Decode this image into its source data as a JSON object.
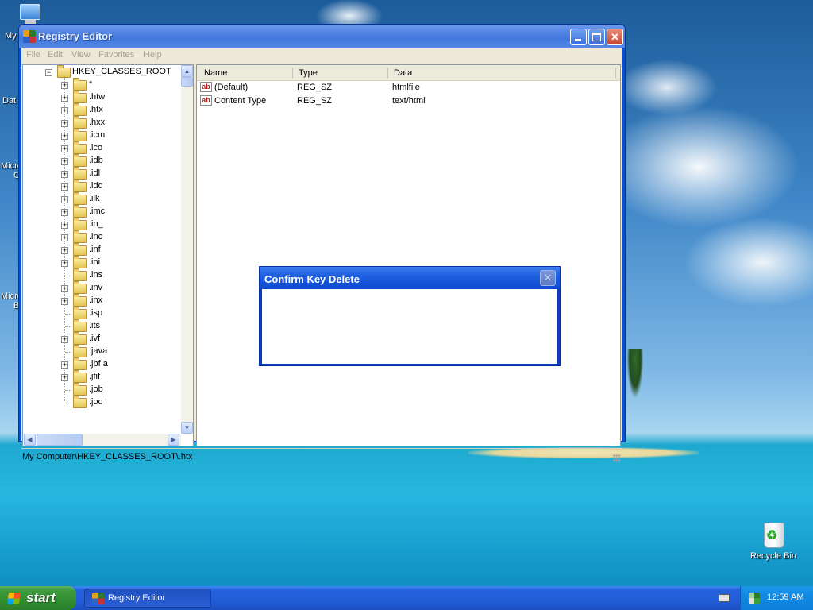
{
  "desktop": {
    "icons": [
      {
        "label": "My"
      },
      {
        "label": "Dat"
      },
      {
        "label": "Micro"
      },
      {
        "label": "C"
      },
      {
        "label": "Micro"
      },
      {
        "label": "B"
      }
    ],
    "recycle_bin": {
      "label": "Recycle Bin"
    }
  },
  "regedit": {
    "title": "Registry Editor",
    "menu": [
      "File",
      "Edit",
      "View",
      "Favorites",
      "Help"
    ],
    "tree": {
      "root": "HKEY_CLASSES_ROOT",
      "items": [
        {
          "label": "*",
          "expandable": true
        },
        {
          "label": ".htw",
          "expandable": true
        },
        {
          "label": ".htx",
          "expandable": true
        },
        {
          "label": ".hxx",
          "expandable": true
        },
        {
          "label": ".icm",
          "expandable": true
        },
        {
          "label": ".ico",
          "expandable": true
        },
        {
          "label": ".idb",
          "expandable": true
        },
        {
          "label": ".idl",
          "expandable": true
        },
        {
          "label": ".idq",
          "expandable": true
        },
        {
          "label": ".ilk",
          "expandable": true
        },
        {
          "label": ".imc",
          "expandable": true
        },
        {
          "label": ".in_",
          "expandable": true
        },
        {
          "label": ".inc",
          "expandable": true
        },
        {
          "label": ".inf",
          "expandable": true
        },
        {
          "label": ".ini",
          "expandable": true
        },
        {
          "label": ".ins",
          "expandable": false
        },
        {
          "label": ".inv",
          "expandable": true
        },
        {
          "label": ".inx",
          "expandable": true
        },
        {
          "label": ".isp",
          "expandable": false
        },
        {
          "label": ".its",
          "expandable": false
        },
        {
          "label": ".ivf",
          "expandable": true
        },
        {
          "label": ".java",
          "expandable": false
        },
        {
          "label": ".jbf a",
          "expandable": true
        },
        {
          "label": ".jfif",
          "expandable": true
        },
        {
          "label": ".job",
          "expandable": false
        },
        {
          "label": ".jod",
          "expandable": false
        }
      ]
    },
    "list": {
      "columns": [
        "Name",
        "Type",
        "Data"
      ],
      "rows": [
        {
          "name": "(Default)",
          "type": "REG_SZ",
          "data": "htmlfile"
        },
        {
          "name": "Content Type",
          "type": "REG_SZ",
          "data": "text/html"
        }
      ]
    },
    "status": "My Computer\\HKEY_CLASSES_ROOT\\.htx"
  },
  "dialog": {
    "title": "Confirm Key Delete",
    "close_glyph": "✕"
  },
  "taskbar": {
    "start_label": "start",
    "items": [
      {
        "label": "Registry Editor"
      }
    ],
    "clock": "12:59 AM"
  },
  "glyphs": {
    "reg_string_icon": "ab",
    "plus": "+",
    "minus": "−",
    "close": "✕",
    "recycle": "♻"
  }
}
